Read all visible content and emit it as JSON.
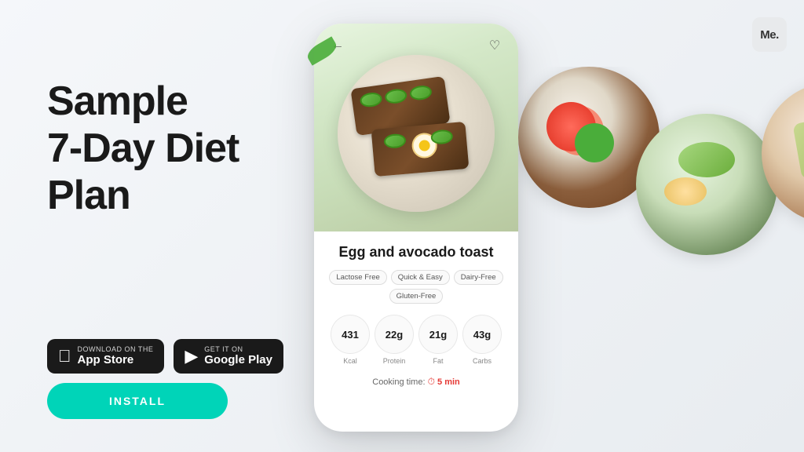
{
  "app": {
    "logo": "Me.",
    "background_color": "#f0f2f5"
  },
  "headline": {
    "line1": "Sample",
    "line2": "7-Day Diet",
    "line3": "Plan"
  },
  "store_buttons": {
    "appstore_small": "Download on the",
    "appstore_large": "App Store",
    "playstore_small": "GET IT ON",
    "playstore_large": "Google Play"
  },
  "install_button": {
    "label": "INSTALL"
  },
  "phone": {
    "recipe": {
      "title": "Egg and avocado toast",
      "tags": [
        "Lactose Free",
        "Quick & Easy",
        "Dairy-Free",
        "Gluten-Free"
      ],
      "nutrition": [
        {
          "value": "431",
          "unit": "",
          "label": "Kcal"
        },
        {
          "value": "22g",
          "unit": "",
          "label": "Protein"
        },
        {
          "value": "21g",
          "unit": "",
          "label": "Fat"
        },
        {
          "value": "43g",
          "unit": "",
          "label": "Carbs"
        }
      ],
      "cooking_time_label": "Cooking time:",
      "cooking_time_value": "5 min"
    }
  }
}
